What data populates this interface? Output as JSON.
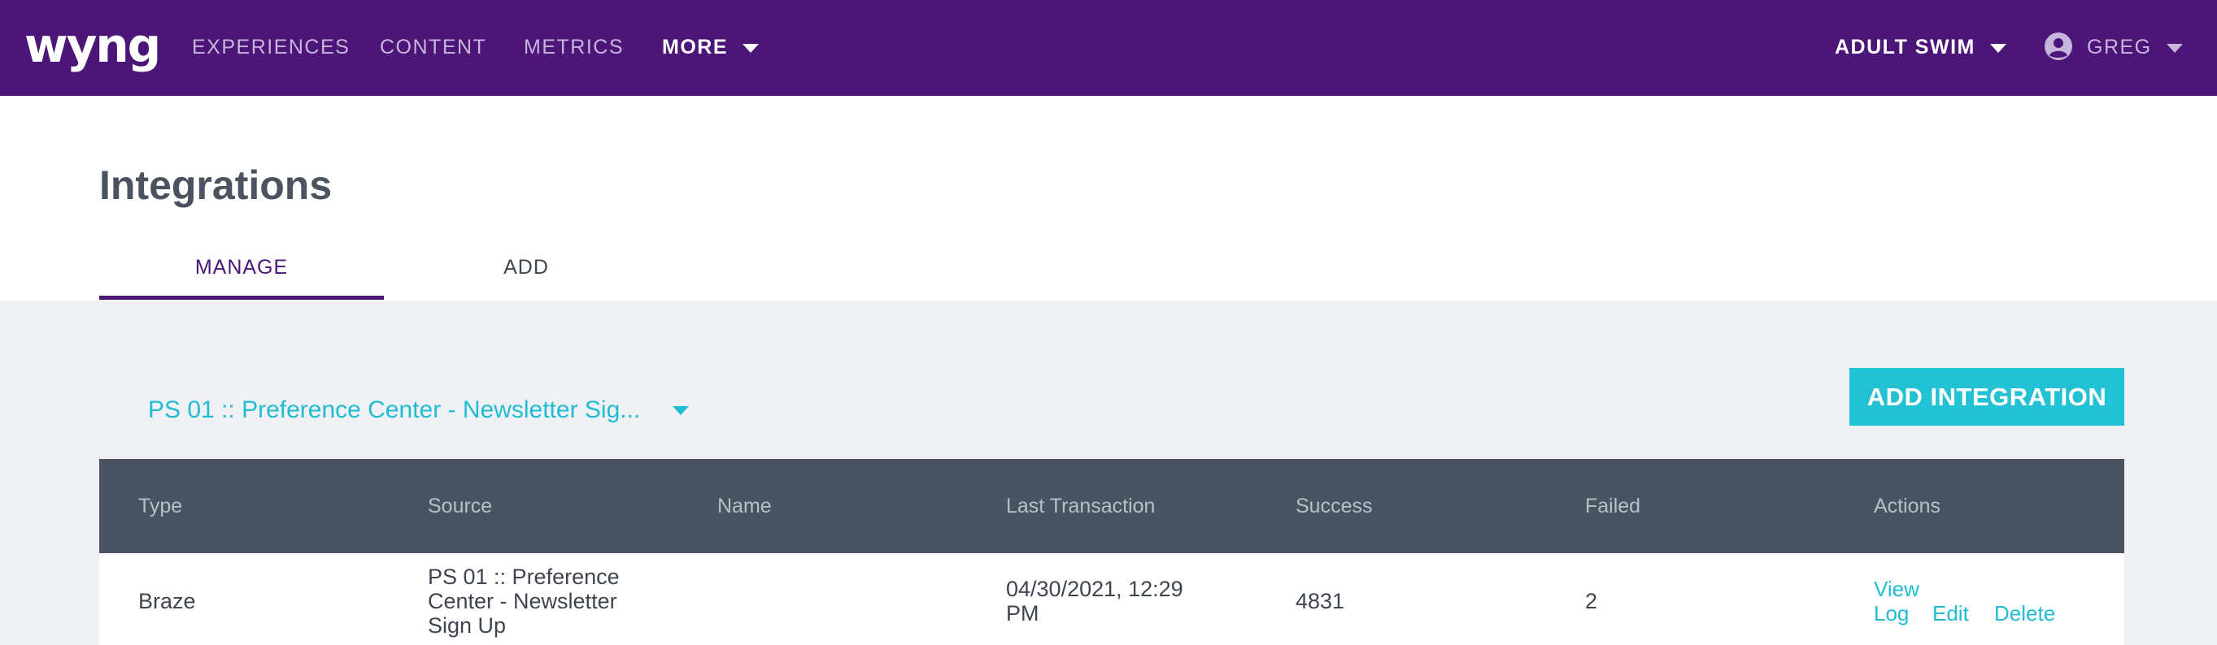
{
  "nav": {
    "logo": "wyng",
    "items": [
      {
        "label": "EXPERIENCES"
      },
      {
        "label": "CONTENT"
      },
      {
        "label": "METRICS"
      },
      {
        "label": "MORE"
      }
    ],
    "account": "ADULT SWIM",
    "user": "GREG"
  },
  "page": {
    "title": "Integrations",
    "tabs": [
      {
        "label": "MANAGE",
        "active": true
      },
      {
        "label": "ADD",
        "active": false
      }
    ]
  },
  "experience_select": {
    "value": "PS 01 :: Preference Center - Newsletter Sig..."
  },
  "add_button": "ADD INTEGRATION",
  "table": {
    "columns": [
      "Type",
      "Source",
      "Name",
      "Last Transaction",
      "Success",
      "Failed",
      "Actions"
    ],
    "rows": [
      {
        "type": "Braze",
        "source_lines": [
          "PS 01 :: Preference",
          "Center - Newsletter",
          "Sign Up"
        ],
        "name": "",
        "last_transaction_lines": [
          "04/30/2021, 12:29",
          "PM"
        ],
        "success": "4831",
        "failed": "2",
        "actions": {
          "view_log_lines": [
            "View",
            "Log"
          ],
          "edit": "Edit",
          "delete": "Delete"
        }
      }
    ]
  },
  "colors": {
    "nav_bg": "#4b1677",
    "accent": "#22c1d4",
    "table_header": "#4a5361",
    "page_bg": "#f0f1f4"
  }
}
